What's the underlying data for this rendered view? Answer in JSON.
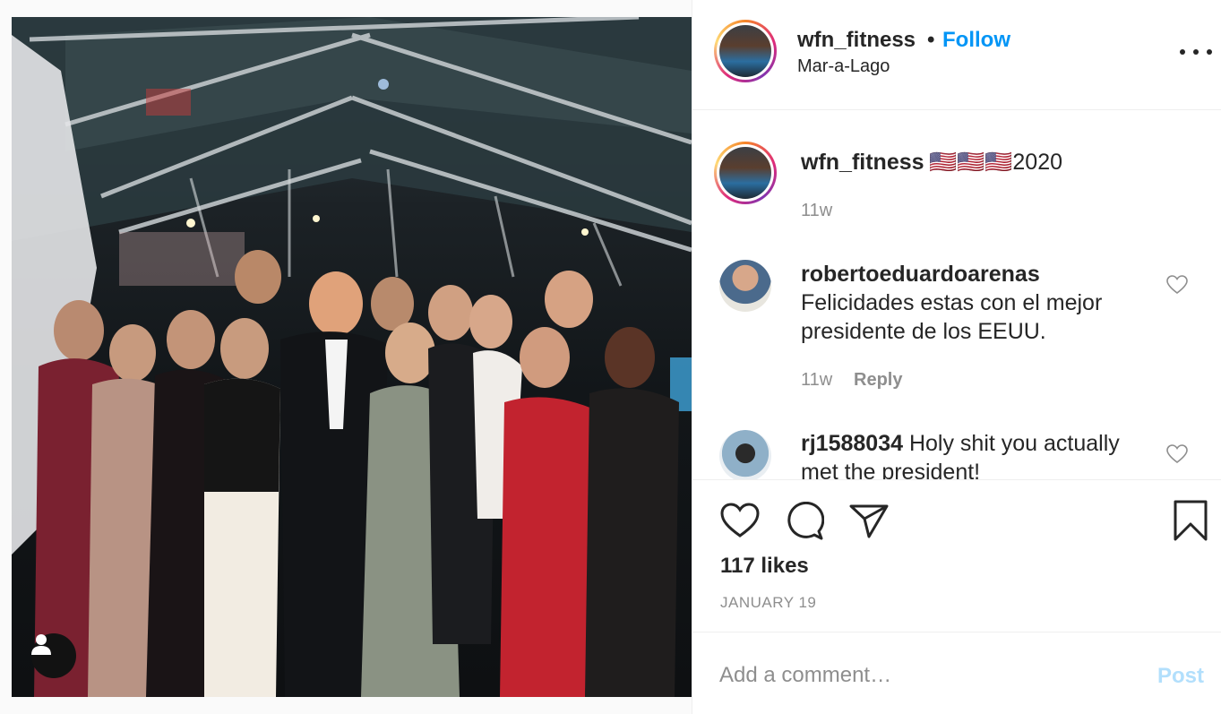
{
  "post": {
    "username": "wfn_fitness",
    "separator": "•",
    "follow_label": "Follow",
    "location": "Mar-a-Lago",
    "caption": "🇺🇸🇺🇸🇺🇸2020",
    "caption_time": "11w",
    "likes": "117 likes",
    "date": "JANUARY 19"
  },
  "comments": [
    {
      "username": "robertoeduardoarenas",
      "text": "Felicidades estas con el mejor presidente de los EEUU.",
      "time": "11w",
      "reply_label": "Reply"
    },
    {
      "username": "rj1588034",
      "text": "Holy shit you actually met the president!"
    }
  ],
  "add_comment": {
    "placeholder": "Add a comment…",
    "post_label": "Post"
  },
  "icons": {
    "like": "heart-icon",
    "comment": "comment-bubble-icon",
    "share": "paper-plane-icon",
    "save": "bookmark-icon",
    "more": "more-options-icon",
    "user_tag": "user-tag-icon"
  },
  "colors": {
    "link_blue": "#0095f6",
    "post_disabled": "#b2dffc",
    "muted_text": "#8e8e8e",
    "text": "#262626"
  }
}
